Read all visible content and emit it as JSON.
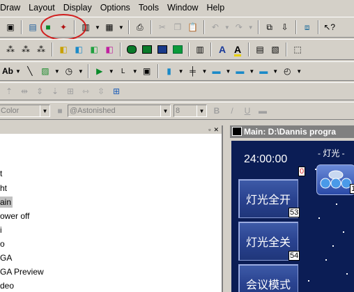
{
  "menu": [
    "Draw",
    "Layout",
    "Display",
    "Options",
    "Tools",
    "Window",
    "Help"
  ],
  "format_toolbar": {
    "color_placeholder": "Color",
    "font_value": "@Astonished",
    "size_value": "8",
    "bold": "B",
    "italic": "/",
    "underline": "U"
  },
  "draw_toolbar": {
    "text_tool": "Ab"
  },
  "tree": [
    "t",
    "ht",
    "ain",
    "ower off",
    "i",
    "o",
    "GA",
    "GA Preview",
    "deo"
  ],
  "window": {
    "title": "Main: D:\\Dannis progra"
  },
  "canvas": {
    "time": "24:00:00",
    "time_num": "0",
    "header": "- 灯光 -",
    "icon_num": "1",
    "buttons": [
      {
        "label": "灯光全开",
        "num": "53"
      },
      {
        "label": "灯光全关",
        "num": "54"
      },
      {
        "label": "会议模式",
        "num": ""
      }
    ]
  },
  "colors": {
    "annotation_circle": "#d21f1f",
    "canvas_bg": "#0b1d55"
  }
}
